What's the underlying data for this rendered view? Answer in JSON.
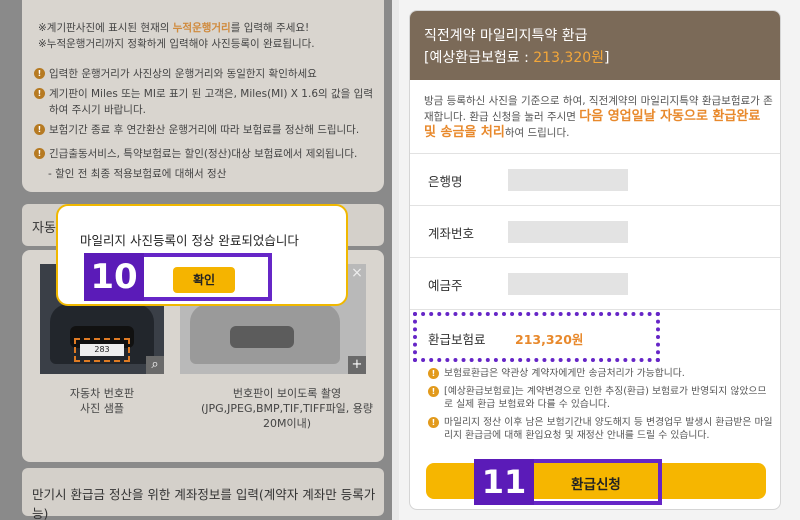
{
  "left": {
    "top_notes": {
      "line1_pre": "※계기판사진에 표시된 현재의",
      "line1_hl": "누적운행거리",
      "line1_post": "를 입력해 주세요!",
      "line2": "※누적운행거리까지 정확하게 입력해야 사진등록이 완료됩니다."
    },
    "notes": [
      "입력한 운행거리가 사진상의 운행거리와 동일한지 확인하세요",
      "계기판이 Miles 또는 MI로 표기 된 고객은, Miles(MI) X 1.6의 값을 입력하여 주시기 바랍니다.",
      "보험기간 종료 후 연간환산 운행거리에 따라 보험료를 정산해 드립니다.",
      "긴급출동서비스, 특약보험료는 할인(정산)대상 보험료에서 제외됩니다."
    ],
    "sub_note": "- 할인 전 최종 적용보험료에 대해서 정산",
    "section_partial": "자동",
    "photo_left_plate": "283",
    "photo_left_caption": "자동차 번호판\n사진 샘플",
    "photo_right_caption": "번호판이 보이도록 촬영\n(JPG,JPEG,BMP,TIF,TIFF파일, 용량\n20M이내)",
    "bottom_section": "만기시 환급금 정산을 위한 계좌정보를 입력(계약자 계좌만 등록가능)",
    "close_glyph": "×",
    "zoom_glyph": "⌕",
    "add_glyph": "+"
  },
  "modal": {
    "message": "마일리지 사진등록이 정상 완료되었습니다",
    "ok_label": "확인"
  },
  "steps": {
    "step10": "10",
    "step11": "11"
  },
  "right": {
    "title": "직전계약 마일리지특약 환급",
    "subtitle_pre": "[예상환급보험료 : ",
    "subtitle_amount": "213,320원",
    "subtitle_post": "]",
    "desc_pre": "방금 등록하신 사진을 기준으로 하여, 직전계약의 마일리지특약 환급보험료가 존재합니다. 환급 신청을 눌러 주시면 ",
    "desc_em": "다음 영업일날 자동으로 환급완료 및 송금을 처리",
    "desc_post": "하여 드립니다.",
    "fields": {
      "bank_label": "은행명",
      "account_label": "계좌번호",
      "holder_label": "예금주",
      "refund_label": "환급보험료",
      "refund_amount": "213,320원"
    },
    "notes": [
      "보험료환급은 약관상 계약자에게만 송금처리가 가능합니다.",
      "[예상환급보험료]는 계약변경으로 인한 추징(환급) 보험료가 반영되지 않았으므로 실제 환급 보험료와 다를 수 있습니다.",
      "마일리지 정산 이후 남은 보험기간내 양도해지 등 변경업무 발생시 환급받은 마일리지 환급금에 대해 환입요청 및 재정산 안내를 드릴 수 있습니다."
    ],
    "apply_label": "환급신청"
  },
  "colors": {
    "accent": "#f5b400",
    "highlight": "#6626c7",
    "header": "#7b6a58",
    "amount": "#e8892c"
  }
}
